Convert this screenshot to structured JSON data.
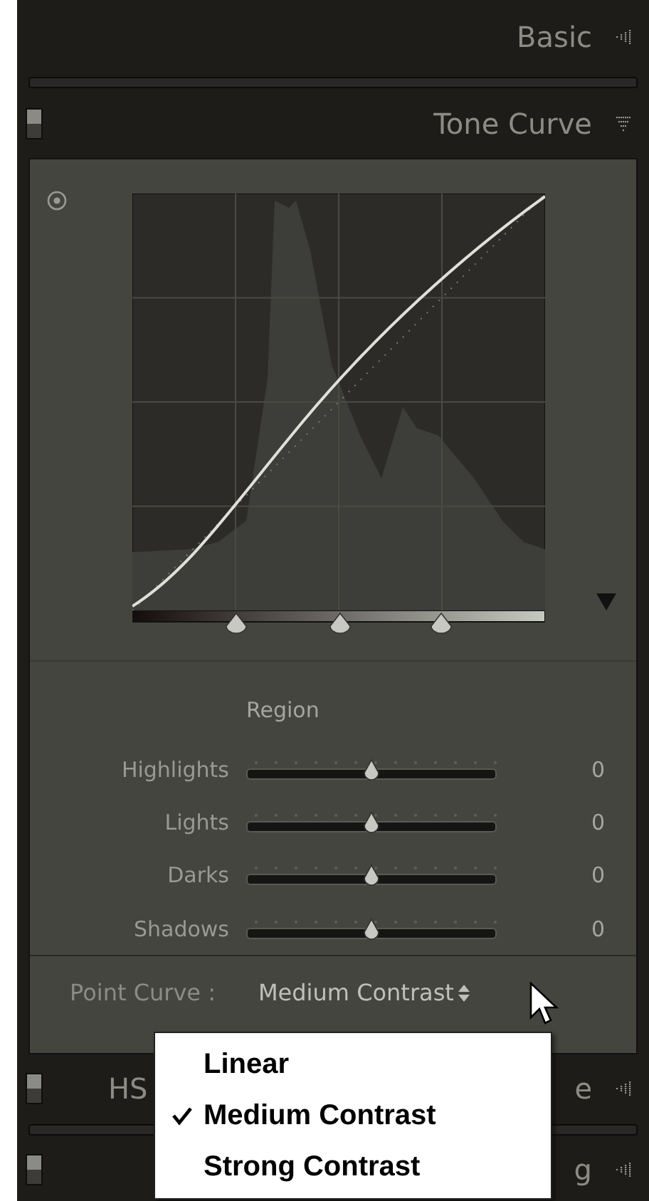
{
  "panels_above": [
    {
      "title": "Basic",
      "expanded": false
    }
  ],
  "tone_curve": {
    "title": "Tone Curve",
    "expanded": true,
    "enabled": true,
    "region": {
      "title": "Region",
      "sliders": [
        {
          "name": "Highlights",
          "level": 0.5,
          "reading": "0"
        },
        {
          "name": "Lights",
          "level": 0.5,
          "reading": "0"
        },
        {
          "name": "Darks",
          "level": 0.5,
          "reading": "0"
        },
        {
          "name": "Shadows",
          "level": 0.5,
          "reading": "0"
        }
      ]
    },
    "point_curve": {
      "label": "Point Curve :",
      "value": "Medium Contrast"
    }
  },
  "panels_below": [
    {
      "title_start": "HS",
      "title_end": "e",
      "expanded": false,
      "enabled": true
    },
    {
      "title_end": "g",
      "expanded": false,
      "enabled": true
    }
  ],
  "point_curve_menu": [
    {
      "label": "Linear",
      "selected": false
    },
    {
      "label": "Medium Contrast",
      "selected": true
    },
    {
      "label": "Strong Contrast",
      "selected": false
    }
  ]
}
